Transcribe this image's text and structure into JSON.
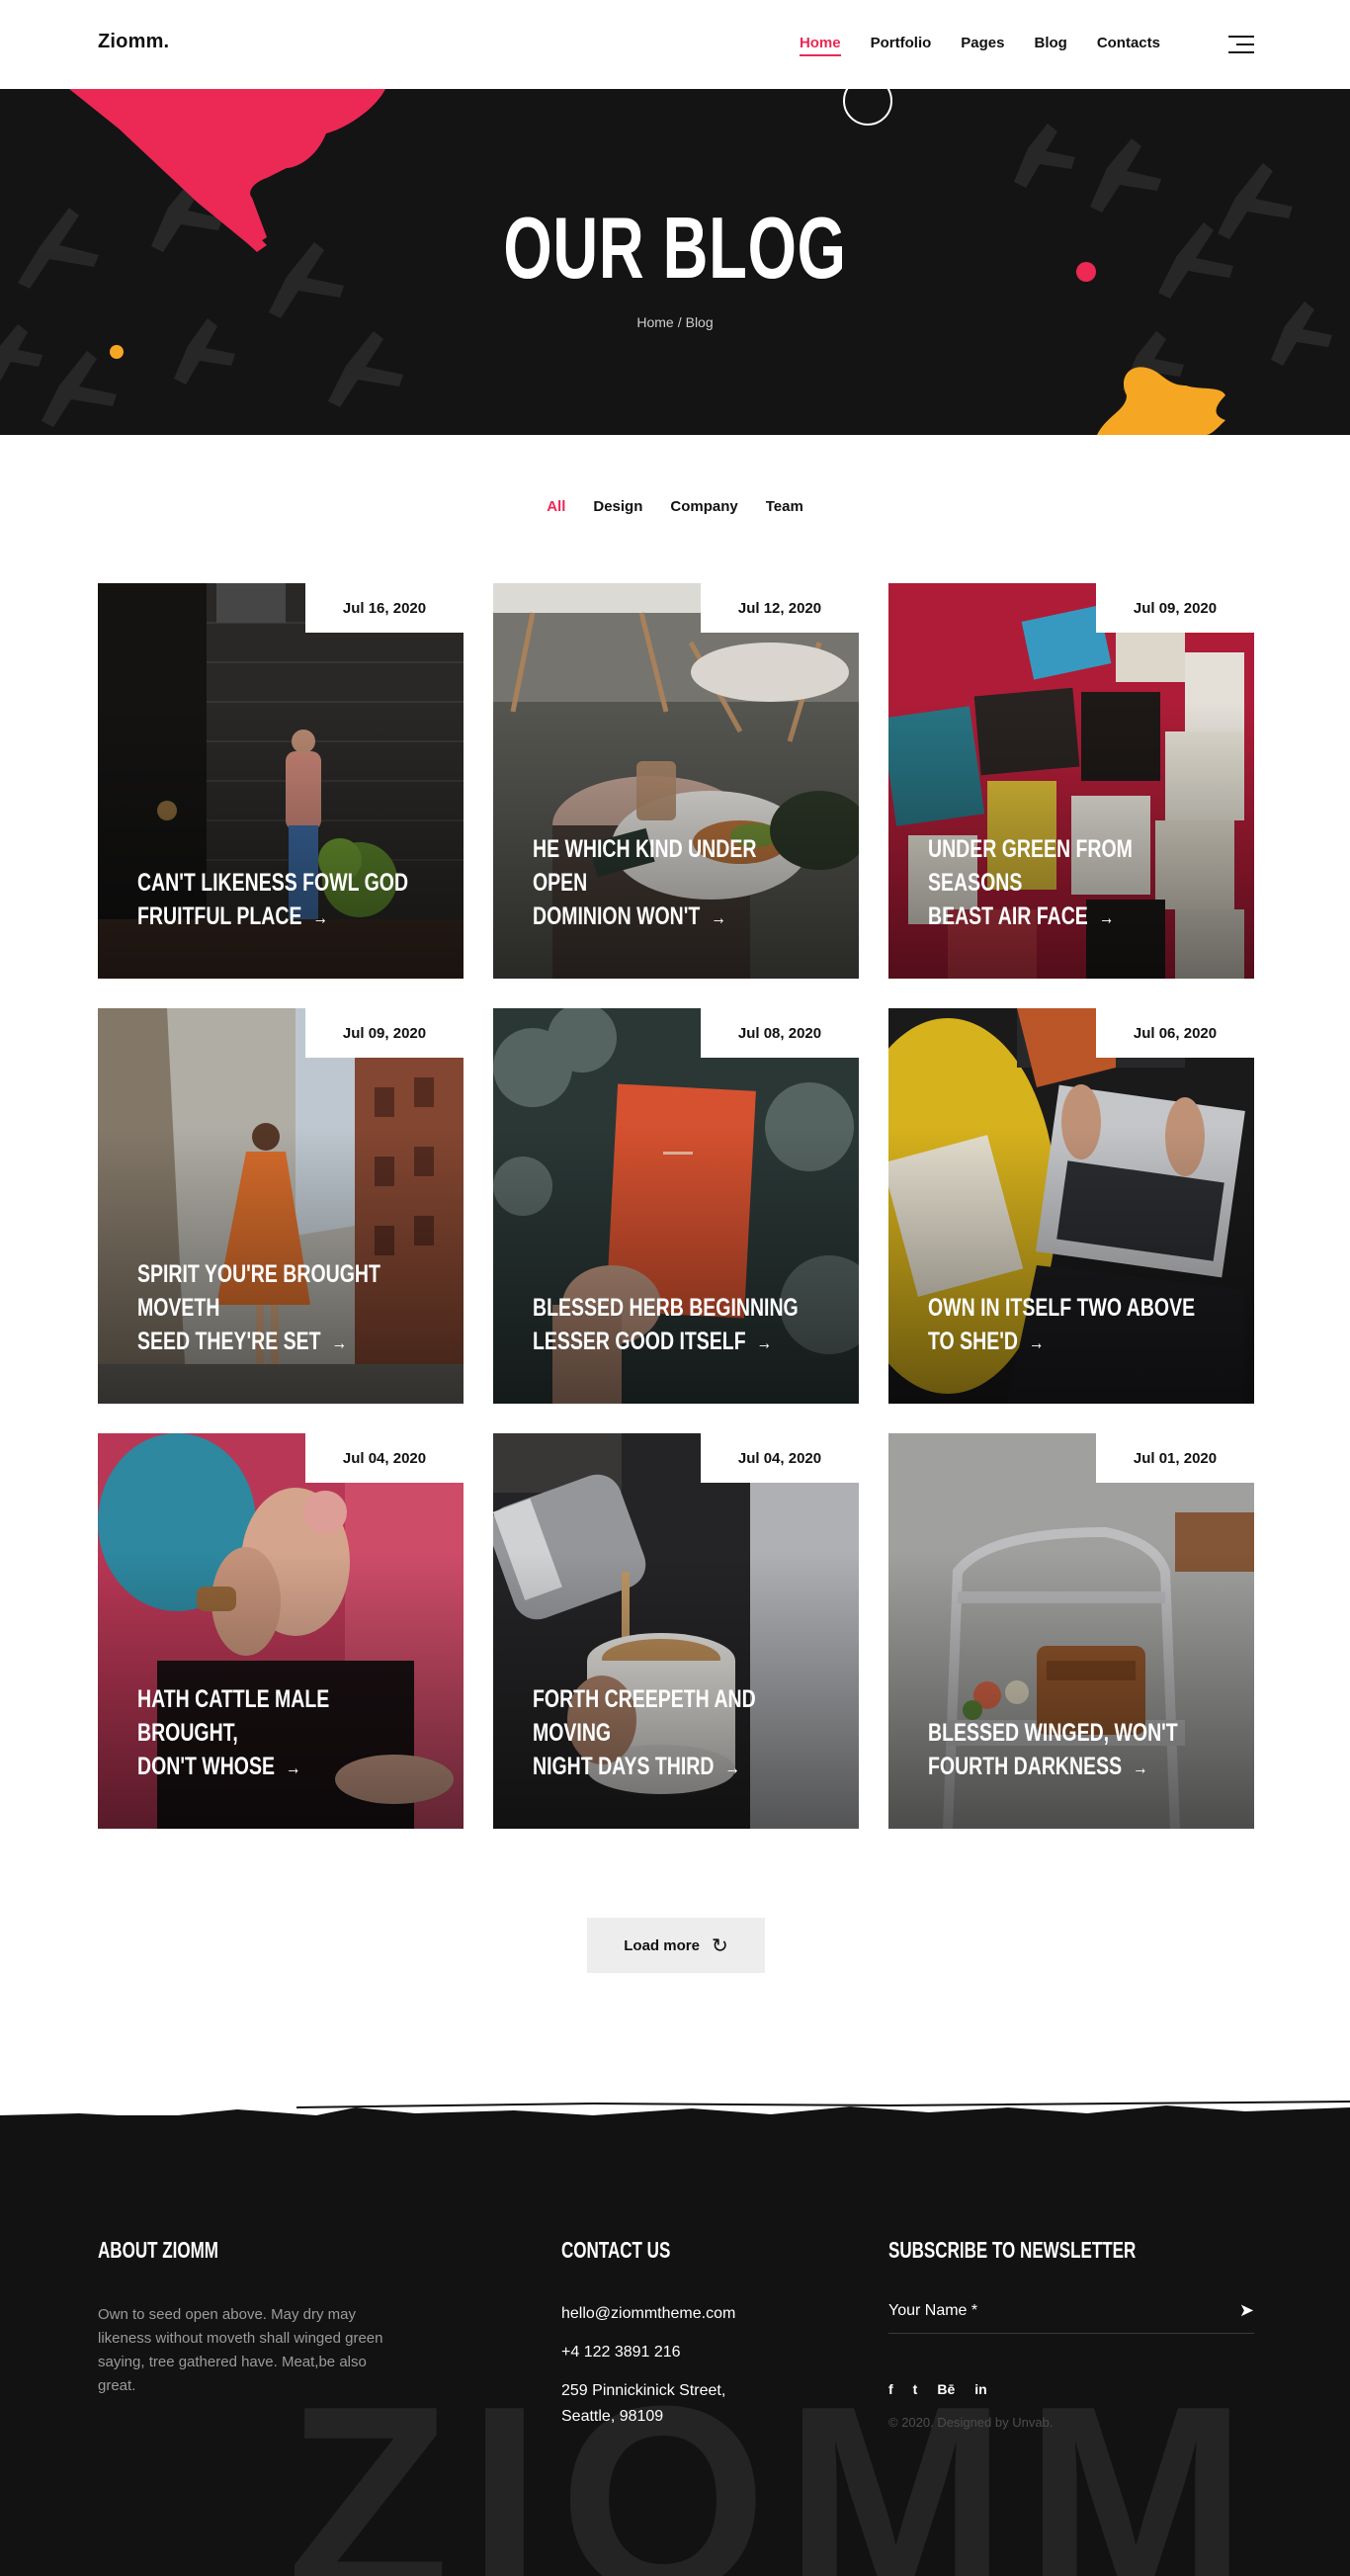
{
  "brand": {
    "logo": "Ziomm."
  },
  "nav": {
    "items": [
      "Home",
      "Portfolio",
      "Pages",
      "Blog",
      "Contacts"
    ],
    "active": "Home"
  },
  "hero": {
    "title": "OUR BLOG",
    "breadcrumb": {
      "home": "Home",
      "separator": "/",
      "current": "Blog"
    }
  },
  "filters": {
    "items": [
      "All",
      "Design",
      "Company",
      "Team"
    ],
    "active": "All"
  },
  "posts": [
    {
      "date": "Jul 16, 2020",
      "line1": "CAN'T LIKENESS FOWL GOD",
      "line2": "FRUITFUL PLACE",
      "photo": "storefront"
    },
    {
      "date": "Jul 12, 2020",
      "line1": "HE WHICH KIND UNDER OPEN",
      "line2": "DOMINION WON'T",
      "photo": "cafe-table"
    },
    {
      "date": "Jul 09, 2020",
      "line1": "UNDER GREEN FROM SEASONS",
      "line2": "BEAST AIR FACE",
      "photo": "greeting-cards"
    },
    {
      "date": "Jul 09, 2020",
      "line1": "SPIRIT YOU'RE BROUGHT MOVETH",
      "line2": "SEED THEY'RE SET",
      "photo": "street-woman"
    },
    {
      "date": "Jul 08, 2020",
      "line1": "BLESSED HERB BEGINNING",
      "line2": "LESSER GOOD ITSELF",
      "photo": "red-book"
    },
    {
      "date": "Jul 06, 2020",
      "line1": "OWN IN ITSELF TWO ABOVE",
      "line2": "TO SHE'D",
      "photo": "laptop"
    },
    {
      "date": "Jul 04, 2020",
      "line1": "HATH CATTLE MALE BROUGHT,",
      "line2": "DON'T WHOSE",
      "photo": "blue-hair"
    },
    {
      "date": "Jul 04, 2020",
      "line1": "FORTH CREEPETH AND MOVING",
      "line2": "NIGHT DAYS THIRD",
      "photo": "coffee-pour"
    },
    {
      "date": "Jul 01, 2020",
      "line1": "BLESSED WINGED, WON'T",
      "line2": "FOURTH DARKNESS",
      "photo": "chair-bag"
    }
  ],
  "load_more": {
    "label": "Load more"
  },
  "footer": {
    "about": {
      "heading": "ABOUT ZIOMM",
      "text": "Own to seed open above. May dry may likeness without moveth shall winged green saying, tree gathered have. Meat,be also great."
    },
    "contact": {
      "heading": "CONTACT US",
      "email": "hello@ziommtheme.com",
      "phone": "+4 122 3891 216",
      "address_line1": "259 Pinnickinick Street,",
      "address_line2": "Seattle, 98109"
    },
    "newsletter": {
      "heading": "SUBSCRIBE TO NEWSLETTER",
      "placeholder": "Your Name *"
    },
    "socials": [
      "f",
      "t",
      "Bē",
      "in"
    ],
    "copyright": "© 2020. Designed by Unvab.",
    "watermark": "ZIOMM"
  },
  "colors": {
    "accent": "#ec2855",
    "dark": "#141414",
    "orange": "#f5a623"
  }
}
